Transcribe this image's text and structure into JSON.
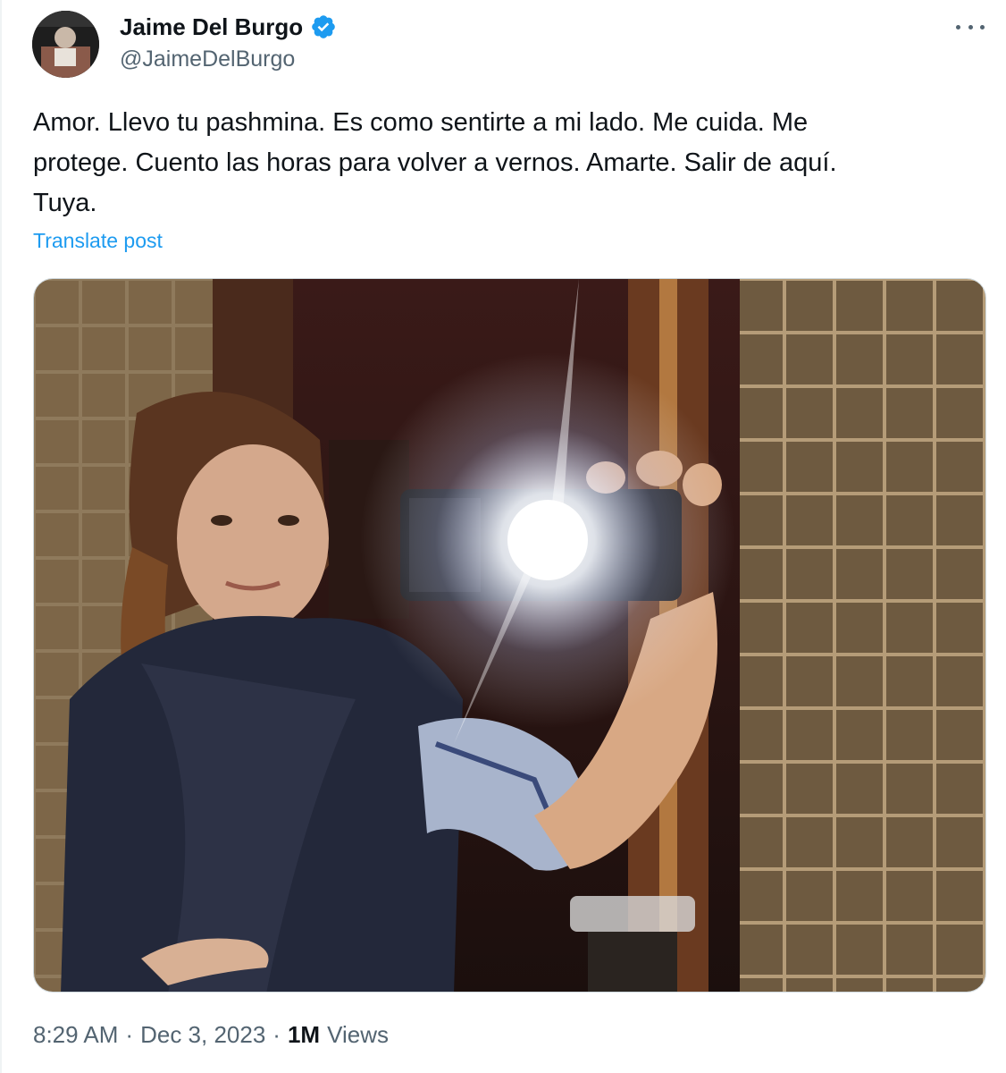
{
  "author": {
    "display_name": "Jaime Del Burgo",
    "handle": "@JaimeDelBurgo",
    "verified": true
  },
  "tweet": {
    "text": "Amor. Llevo tu pashmina. Es como sentirte a mi lado. Me cuida. Me\nprotege. Cuento las horas para volver a vernos. Amarte. Salir de aquí.\nTuya.",
    "translate_label": "Translate post"
  },
  "meta": {
    "time": "8:29 AM",
    "separator": "·",
    "date": "Dec 3, 2023",
    "views_count": "1M",
    "views_label": "Views"
  },
  "colors": {
    "link": "#1d9bf0",
    "verified": "#1d9bf0",
    "secondary_text": "#536471"
  },
  "icons": {
    "verified": "verified-badge-icon",
    "more": "more-horizontal-icon"
  }
}
